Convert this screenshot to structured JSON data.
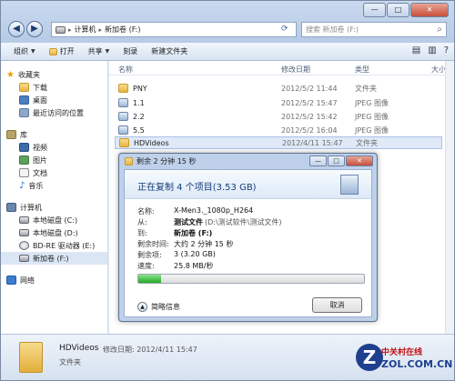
{
  "window": {
    "address_path": [
      "计算机",
      "新加卷 (F:)"
    ],
    "search_placeholder": "搜索 新加卷 (F:)",
    "caption": {
      "min": "—",
      "max": "□",
      "close": "✕"
    }
  },
  "toolbar": {
    "organize": "组织",
    "open": "打开",
    "share": "共享",
    "burn": "刻录",
    "new_folder": "新建文件夹"
  },
  "nav": {
    "favorites": {
      "label": "收藏夹",
      "items": [
        "下载",
        "桌面",
        "最近访问的位置"
      ]
    },
    "libraries": {
      "label": "库",
      "items": [
        "视频",
        "图片",
        "文档",
        "音乐"
      ]
    },
    "computer": {
      "label": "计算机",
      "items": [
        "本地磁盘 (C:)",
        "本地磁盘 (D:)",
        "BD-RE 驱动器 (E:)",
        "新加卷 (F:)"
      ]
    },
    "network": {
      "label": "网络"
    }
  },
  "columns": {
    "name": "名称",
    "date": "修改日期",
    "type": "类型",
    "size": "大小"
  },
  "files": [
    {
      "name": "PNY",
      "date": "2012/5/2 11:44",
      "type": "文件夹",
      "icon": "folder"
    },
    {
      "name": "1.1",
      "date": "2012/5/2 15:47",
      "type": "JPEG 图像",
      "icon": "jpeg"
    },
    {
      "name": "2.2",
      "date": "2012/5/2 15:42",
      "type": "JPEG 图像",
      "icon": "jpeg"
    },
    {
      "name": "5.5",
      "date": "2012/5/2 16:04",
      "type": "JPEG 图像",
      "icon": "jpeg"
    },
    {
      "name": "HDVideos",
      "date": "2012/4/11 15:47",
      "type": "文件夹",
      "icon": "folder"
    }
  ],
  "details": {
    "name": "HDVideos",
    "modified": "修改日期: 2012/4/11 15:47",
    "type": "文件夹"
  },
  "logo": {
    "cn": "中关村在线",
    "domain": "ZOL.COM.CN",
    "mark": "Z"
  },
  "dialog": {
    "title": "剩余 2 分钟 15 秒",
    "header": "正在复制 4 个项目(3.53 GB)",
    "name_label": "名称:",
    "name_value": "X-Men3._1080p_H264",
    "from_label": "从:",
    "from_value": "测试文件",
    "from_path": "(D:\\测试软件\\测试文件)",
    "to_label": "到:",
    "to_value": "新加卷 (F:)",
    "remaining_time_label": "剩余时间:",
    "remaining_time_value": "大约 2 分钟 15 秒",
    "remaining_items_label": "剩余项:",
    "remaining_items_value": "3 (3.20 GB)",
    "speed_label": "速度:",
    "speed_value": "25.8 MB/秒",
    "progress": 0.1,
    "less_details": "简略信息",
    "cancel": "取消"
  }
}
